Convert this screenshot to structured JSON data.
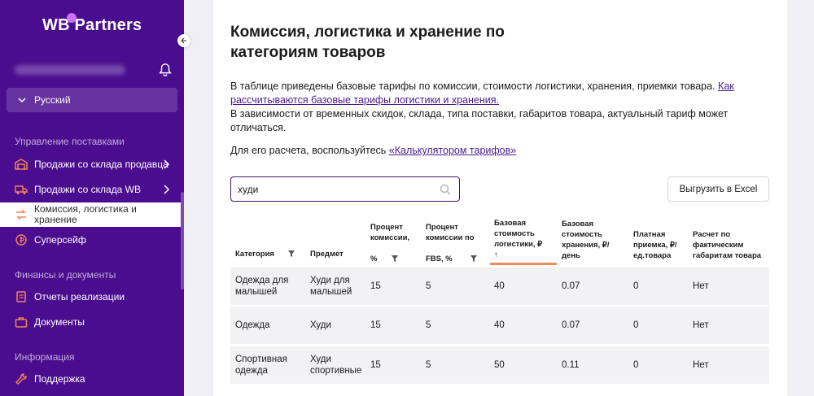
{
  "brand": {
    "logo_left": "WB",
    "logo_right": "Partners"
  },
  "sidebar": {
    "language": "Русский",
    "sections": {
      "supply": "Управление поставками",
      "finance": "Финансы и документы",
      "info": "Информация"
    },
    "items": [
      {
        "label": "Продажи со склада продавца",
        "icon": "warehouse-icon"
      },
      {
        "label": "Продажи со склада WB",
        "icon": "truck-icon"
      },
      {
        "label": "Комиссия, логистика и хранение",
        "icon": "exchange-icon"
      },
      {
        "label": "Суперсейф",
        "icon": "coin-icon"
      },
      {
        "label": "Отчеты реализации",
        "icon": "report-icon"
      },
      {
        "label": "Документы",
        "icon": "briefcase-icon"
      },
      {
        "label": "Поддержка",
        "icon": "wrench-icon"
      }
    ]
  },
  "main": {
    "title": "Комиссия, логистика и хранение по категориям товаров",
    "desc_text": "В таблице приведены базовые тарифы по комиссии, стоимости логистики, хранения, приемки товара. ",
    "desc_link": "Как рассчитываются базовые тарифы логистики и хранения.",
    "desc_text2": "В зависимости от временных скидок, склада, типа поставки, габаритов товара, актуальный тариф может отличаться.",
    "calc_text": "Для его расчета, воспользуйтесь ",
    "calc_link": "«Калькулятором тарифов»",
    "search_value": "худи",
    "export_label": "Выгрузить в Excel"
  },
  "table": {
    "headers": {
      "category": "Категория",
      "subject": "Предмет",
      "commission_1": "Процент комиссии,",
      "commission_2": "%",
      "fbs_1": "Процент комиссии по",
      "fbs_2": "FBS, %",
      "logistics": "Базовая стоимость логистики, ₽",
      "logistics_sort": "↑",
      "storage": "Базовая стоимость хранения, ₽/день",
      "acceptance": "Платная приемка, ₽/ед.товара",
      "actual": "Расчет по фактическим габаритам товара"
    },
    "rows": [
      {
        "category": "Одежда для малышей",
        "subject": "Худи для малышей",
        "commission": "15",
        "fbs": "5",
        "logistics": "40",
        "storage": "0.07",
        "acceptance": "0",
        "actual": "Нет"
      },
      {
        "category": "Одежда",
        "subject": "Худи",
        "commission": "15",
        "fbs": "5",
        "logistics": "40",
        "storage": "0.07",
        "acceptance": "0",
        "actual": "Нет"
      },
      {
        "category": "Спортивная одежда",
        "subject": "Худи спортивные",
        "commission": "15",
        "fbs": "5",
        "logistics": "50",
        "storage": "0.11",
        "acceptance": "0",
        "actual": "Нет"
      }
    ]
  }
}
